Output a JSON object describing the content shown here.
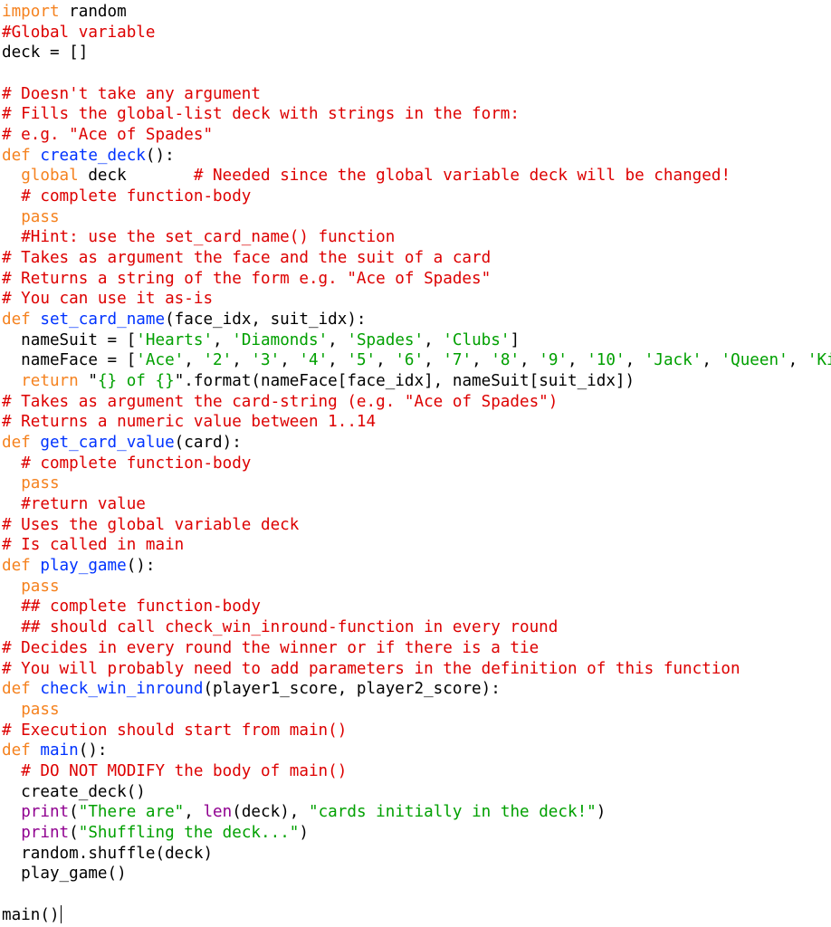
{
  "editor": {
    "language": "python",
    "colors": {
      "keyword": "#f5821f",
      "comment": "#dd0000",
      "function_name": "#0033ff",
      "string": "#00a000",
      "builtin": "#900090",
      "plain": "#000000"
    },
    "cursor_line": 45,
    "lines": [
      [
        [
          "kw",
          "import"
        ],
        [
          "plain",
          " random"
        ]
      ],
      [
        [
          "cm",
          "#Global variable"
        ]
      ],
      [
        [
          "plain",
          "deck = []"
        ]
      ],
      [],
      [
        [
          "cm",
          "# Doesn't take any argument"
        ]
      ],
      [
        [
          "cm",
          "# Fills the global-list deck with strings in the form:"
        ]
      ],
      [
        [
          "cm",
          "# e.g. \"Ace of Spades\""
        ]
      ],
      [
        [
          "kw",
          "def"
        ],
        [
          "plain",
          " "
        ],
        [
          "fn",
          "create_deck"
        ],
        [
          "plain",
          "():"
        ]
      ],
      [
        [
          "plain",
          "  "
        ],
        [
          "kw",
          "global"
        ],
        [
          "plain",
          " deck       "
        ],
        [
          "cm",
          "# Needed since the global variable deck will be changed!"
        ]
      ],
      [
        [
          "plain",
          "  "
        ],
        [
          "cm",
          "# complete function-body"
        ]
      ],
      [
        [
          "plain",
          "  "
        ],
        [
          "kw",
          "pass"
        ]
      ],
      [
        [
          "plain",
          "  "
        ],
        [
          "cm",
          "#Hint: use the set_card_name() function"
        ]
      ],
      [
        [
          "cm",
          "# Takes as argument the face and the suit of a card"
        ]
      ],
      [
        [
          "cm",
          "# Returns a string of the form e.g. \"Ace of Spades\""
        ]
      ],
      [
        [
          "cm",
          "# You can use it as-is"
        ]
      ],
      [
        [
          "kw",
          "def"
        ],
        [
          "plain",
          " "
        ],
        [
          "fn",
          "set_card_name"
        ],
        [
          "plain",
          "(face_idx, suit_idx):"
        ]
      ],
      [
        [
          "plain",
          "  nameSuit = ["
        ],
        [
          "str",
          "'Hearts'"
        ],
        [
          "plain",
          ", "
        ],
        [
          "str",
          "'Diamonds'"
        ],
        [
          "plain",
          ", "
        ],
        [
          "str",
          "'Spades'"
        ],
        [
          "plain",
          ", "
        ],
        [
          "str",
          "'Clubs'"
        ],
        [
          "plain",
          "]"
        ]
      ],
      [
        [
          "plain",
          "  nameFace = ["
        ],
        [
          "str",
          "'Ace'"
        ],
        [
          "plain",
          ", "
        ],
        [
          "str",
          "'2'"
        ],
        [
          "plain",
          ", "
        ],
        [
          "str",
          "'3'"
        ],
        [
          "plain",
          ", "
        ],
        [
          "str",
          "'4'"
        ],
        [
          "plain",
          ", "
        ],
        [
          "str",
          "'5'"
        ],
        [
          "plain",
          ", "
        ],
        [
          "str",
          "'6'"
        ],
        [
          "plain",
          ", "
        ],
        [
          "str",
          "'7'"
        ],
        [
          "plain",
          ", "
        ],
        [
          "str",
          "'8'"
        ],
        [
          "plain",
          ", "
        ],
        [
          "str",
          "'9'"
        ],
        [
          "plain",
          ", "
        ],
        [
          "str",
          "'10'"
        ],
        [
          "plain",
          ", "
        ],
        [
          "str",
          "'Jack'"
        ],
        [
          "plain",
          ", "
        ],
        [
          "str",
          "'Queen'"
        ],
        [
          "plain",
          ", "
        ],
        [
          "str",
          "'King'"
        ],
        [
          "plain",
          "]"
        ]
      ],
      [
        [
          "plain",
          "  "
        ],
        [
          "kw",
          "return"
        ],
        [
          "plain",
          " \""
        ],
        [
          "str",
          "{} of {}"
        ],
        [
          "plain",
          "\".format(nameFace[face_idx], nameSuit[suit_idx])"
        ]
      ],
      [
        [
          "cm",
          "# Takes as argument the card-string (e.g. \"Ace of Spades\")"
        ]
      ],
      [
        [
          "cm",
          "# Returns a numeric value between 1..14"
        ]
      ],
      [
        [
          "kw",
          "def"
        ],
        [
          "plain",
          " "
        ],
        [
          "fn",
          "get_card_value"
        ],
        [
          "plain",
          "(card):"
        ]
      ],
      [
        [
          "plain",
          "  "
        ],
        [
          "cm",
          "# complete function-body"
        ]
      ],
      [
        [
          "plain",
          "  "
        ],
        [
          "kw",
          "pass"
        ]
      ],
      [
        [
          "plain",
          "  "
        ],
        [
          "cm",
          "#return value"
        ]
      ],
      [
        [
          "cm",
          "# Uses the global variable deck"
        ]
      ],
      [
        [
          "cm",
          "# Is called in main"
        ]
      ],
      [
        [
          "kw",
          "def"
        ],
        [
          "plain",
          " "
        ],
        [
          "fn",
          "play_game"
        ],
        [
          "plain",
          "():"
        ]
      ],
      [
        [
          "plain",
          "  "
        ],
        [
          "kw",
          "pass"
        ]
      ],
      [
        [
          "plain",
          "  "
        ],
        [
          "cm",
          "## complete function-body"
        ]
      ],
      [
        [
          "plain",
          "  "
        ],
        [
          "cm",
          "## should call check_win_inround-function in every round"
        ]
      ],
      [
        [
          "cm",
          "# Decides in every round the winner or if there is a tie"
        ]
      ],
      [
        [
          "cm",
          "# You will probably need to add parameters in the definition of this function"
        ]
      ],
      [
        [
          "kw",
          "def"
        ],
        [
          "plain",
          " "
        ],
        [
          "fn",
          "check_win_inround"
        ],
        [
          "plain",
          "(player1_score, player2_score):"
        ]
      ],
      [
        [
          "plain",
          "  "
        ],
        [
          "kw",
          "pass"
        ]
      ],
      [
        [
          "cm",
          "# Execution should start from main()"
        ]
      ],
      [
        [
          "kw",
          "def"
        ],
        [
          "plain",
          " "
        ],
        [
          "fn",
          "main"
        ],
        [
          "plain",
          "():"
        ]
      ],
      [
        [
          "plain",
          "  "
        ],
        [
          "cm",
          "# DO NOT MODIFY the body of main()"
        ]
      ],
      [
        [
          "plain",
          "  create_deck()"
        ]
      ],
      [
        [
          "plain",
          "  "
        ],
        [
          "bi",
          "print"
        ],
        [
          "plain",
          "("
        ],
        [
          "str",
          "\"There are\""
        ],
        [
          "plain",
          ", "
        ],
        [
          "bi",
          "len"
        ],
        [
          "plain",
          "(deck), "
        ],
        [
          "str",
          "\"cards initially in the deck!\""
        ],
        [
          "plain",
          ")"
        ]
      ],
      [
        [
          "plain",
          "  "
        ],
        [
          "bi",
          "print"
        ],
        [
          "plain",
          "("
        ],
        [
          "str",
          "\"Shuffling the deck...\""
        ],
        [
          "plain",
          ")"
        ]
      ],
      [
        [
          "plain",
          "  random.shuffle(deck)"
        ]
      ],
      [
        [
          "plain",
          "  play_game()"
        ]
      ],
      [],
      [
        [
          "plain",
          "main()"
        ]
      ]
    ]
  }
}
